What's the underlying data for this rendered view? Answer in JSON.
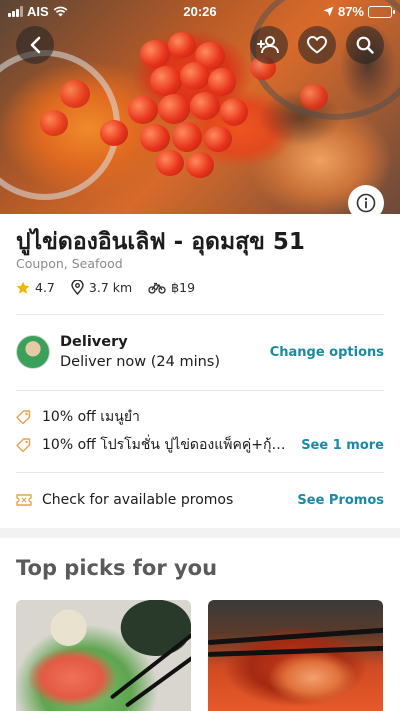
{
  "status_bar": {
    "carrier": "AIS",
    "time": "20:26",
    "battery": "87%",
    "battery_level": 0.87
  },
  "hero": {
    "back_icon": "chevron-left-icon",
    "group_order_icon": "add-user-icon",
    "favorite_icon": "heart-icon",
    "search_icon": "search-icon",
    "info_icon": "info-icon"
  },
  "restaurant": {
    "name": "ปูไข่ดองอินเลิฟ - อุดมสุข 51",
    "categories": "Coupon, Seafood",
    "rating": "4.7",
    "distance": "3.7 km",
    "delivery_fee": "฿19"
  },
  "delivery": {
    "label": "Delivery",
    "eta": "Deliver now (24 mins)",
    "change_label": "Change options"
  },
  "promos": [
    {
      "text": "10% off เมนูยำ",
      "link": ""
    },
    {
      "text": "10% off โปรโมชั่น ปูไข่ดองแพ็คคู่+กุ้งแช่...",
      "link": "See 1 more"
    }
  ],
  "promo_check": {
    "text": "Check for available promos",
    "link": "See Promos"
  },
  "top_picks": {
    "title": "Top picks for you"
  },
  "colors": {
    "accent": "#1a8aa4",
    "star": "#f5b400",
    "battery": "#4cd964"
  }
}
